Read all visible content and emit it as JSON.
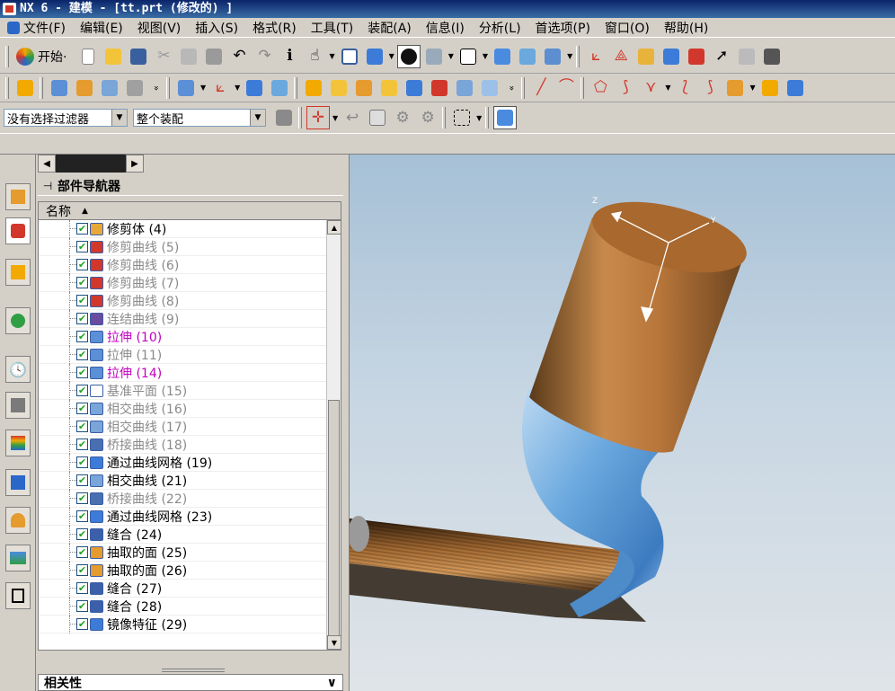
{
  "window": {
    "title": "NX 6 - 建模 - [tt.prt (修改的) ]"
  },
  "menu": {
    "items": [
      "文件(F)",
      "编辑(E)",
      "视图(V)",
      "插入(S)",
      "格式(R)",
      "工具(T)",
      "装配(A)",
      "信息(I)",
      "分析(L)",
      "首选项(P)",
      "窗口(O)",
      "帮助(H)"
    ]
  },
  "toolbar": {
    "start_label": "开始·",
    "filter_value": "没有选择过滤器",
    "scope_value": "整个装配"
  },
  "navigator": {
    "title": "部件导航器",
    "pin_glyph": "⊣",
    "column_name": "名称",
    "rows": [
      {
        "label": "修剪体 (4)",
        "style": "normal",
        "icon_color": "#e8a838"
      },
      {
        "label": "修剪曲线 (5)",
        "style": "gray",
        "icon_color": "#d1382b"
      },
      {
        "label": "修剪曲线 (6)",
        "style": "gray",
        "icon_color": "#d1382b"
      },
      {
        "label": "修剪曲线 (7)",
        "style": "gray",
        "icon_color": "#d1382b"
      },
      {
        "label": "修剪曲线 (8)",
        "style": "gray",
        "icon_color": "#d1382b"
      },
      {
        "label": "连结曲线 (9)",
        "style": "gray",
        "icon_color": "#6a4b9e"
      },
      {
        "label": "拉伸 (10)",
        "style": "magenta",
        "icon_color": "#5b8fd6"
      },
      {
        "label": "拉伸 (11)",
        "style": "gray",
        "icon_color": "#5b8fd6"
      },
      {
        "label": "拉伸 (14)",
        "style": "magenta",
        "icon_color": "#5b8fd6"
      },
      {
        "label": "基准平面 (15)",
        "style": "gray",
        "icon_color": "#ffffff"
      },
      {
        "label": "相交曲线 (16)",
        "style": "gray",
        "icon_color": "#7aa5d8"
      },
      {
        "label": "相交曲线 (17)",
        "style": "gray",
        "icon_color": "#7aa5d8"
      },
      {
        "label": "桥接曲线 (18)",
        "style": "gray",
        "icon_color": "#4a6fb0"
      },
      {
        "label": "通过曲线网格 (19)",
        "style": "normal",
        "icon_color": "#3d7bd8"
      },
      {
        "label": "相交曲线 (21)",
        "style": "normal",
        "icon_color": "#7aa5d8"
      },
      {
        "label": "桥接曲线 (22)",
        "style": "gray",
        "icon_color": "#4a6fb0"
      },
      {
        "label": "通过曲线网格 (23)",
        "style": "normal",
        "icon_color": "#3d7bd8"
      },
      {
        "label": "缝合 (24)",
        "style": "normal",
        "icon_color": "#3b5fa8"
      },
      {
        "label": "抽取的面 (25)",
        "style": "normal",
        "icon_color": "#e59b2e"
      },
      {
        "label": "抽取的面 (26)",
        "style": "normal",
        "icon_color": "#e59b2e"
      },
      {
        "label": "缝合 (27)",
        "style": "normal",
        "icon_color": "#3b5fa8"
      },
      {
        "label": "缝合 (28)",
        "style": "normal",
        "icon_color": "#3b5fa8"
      },
      {
        "label": "镜像特征 (29)",
        "style": "normal",
        "icon_color": "#3d7bd8"
      }
    ],
    "check_glyph": "✔"
  },
  "dependencies": {
    "title": "相关性",
    "collapse_glyph": "∨"
  },
  "scene": {
    "copper": "#b8763a",
    "blue_surface": "#6aa8de",
    "axis_labels": [
      "Z",
      "Y"
    ]
  }
}
